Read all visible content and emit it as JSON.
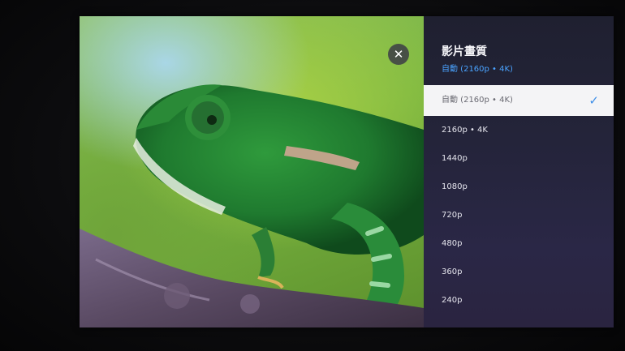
{
  "panel": {
    "title": "影片畫質",
    "subtitle": "自動 (2160p • 4K)",
    "accent_color": "#4aa3ff",
    "options": [
      {
        "label": "自動 (2160p • 4K)",
        "selected": true
      },
      {
        "label": "2160p • 4K",
        "selected": false
      },
      {
        "label": "1440p",
        "selected": false
      },
      {
        "label": "1080p",
        "selected": false
      },
      {
        "label": "720p",
        "selected": false
      },
      {
        "label": "480p",
        "selected": false
      },
      {
        "label": "360p",
        "selected": false
      },
      {
        "label": "240p",
        "selected": false
      }
    ]
  },
  "player": {
    "close_icon": "close-icon",
    "close_glyph": "✕",
    "check_glyph": "✓"
  }
}
